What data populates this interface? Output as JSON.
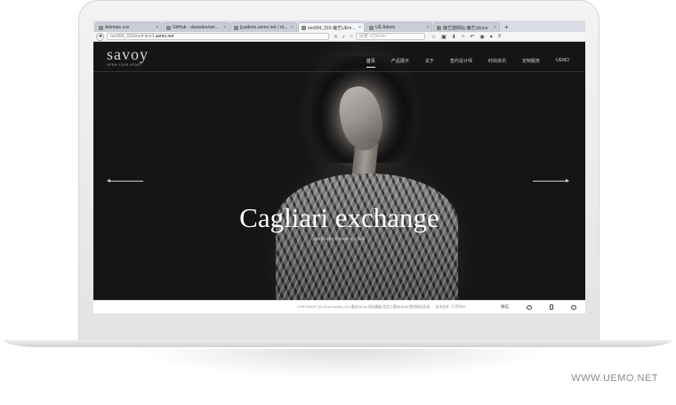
{
  "browser": {
    "tabs": [
      {
        "label": "Animate.css",
        "active": false
      },
      {
        "label": "GitHub - daneden/anim...",
        "active": false
      },
      {
        "label": "jiyadmin.uemo.net / rds...",
        "active": false
      },
      {
        "label": "mo004_310-魔艺UEmo 网站...",
        "active": true
      },
      {
        "label": "UE Admin",
        "active": false
      },
      {
        "label": "魔艺建网站-魔艺UEmo",
        "active": false
      }
    ],
    "new_tab": "+",
    "close_glyph": "×",
    "back_glyph": "◄",
    "url_prefix": "mo004_310/mo4.lins3.",
    "url_host": "uemo.net",
    "url_tools": [
      "✕",
      "✓",
      "⌂"
    ],
    "search_placeholder": "百度 <Ctrl+K>",
    "toolbar_icons": [
      "☆",
      "▣",
      "⬇",
      "⌂",
      "↶",
      "◉",
      "▾",
      "≡"
    ]
  },
  "site": {
    "logo": "savoy",
    "logo_sub": "OPEN YOUR HEART",
    "nav": [
      {
        "label": "首页",
        "active": true
      },
      {
        "label": "产品展示",
        "active": false
      },
      {
        "label": "关于",
        "active": false
      },
      {
        "label": "签约设计师",
        "active": false
      },
      {
        "label": "时尚资讯",
        "active": false
      },
      {
        "label": "定制服务",
        "active": false
      },
      {
        "label": "UEMO",
        "active": false
      }
    ],
    "slide_title": "Cagliari exchange",
    "slide_subtitle": "ambient beauty club",
    "footer": {
      "copyright": "COPYRIGHT (©) 2016 mo004_310-魔艺UEmo 网站模板.您定义建站UEMO提供网站生成",
      "tech_label": "技术支持",
      "tech_brand": "UEmo",
      "items": [
        {
          "label": "微信",
          "icon": "wechat-icon"
        },
        {
          "label": "",
          "icon": "weibo-icon"
        },
        {
          "label": "",
          "icon": "phone-icon"
        },
        {
          "label": "",
          "icon": "chat-icon"
        }
      ]
    }
  },
  "watermark": "WWW.UEMO.NET"
}
